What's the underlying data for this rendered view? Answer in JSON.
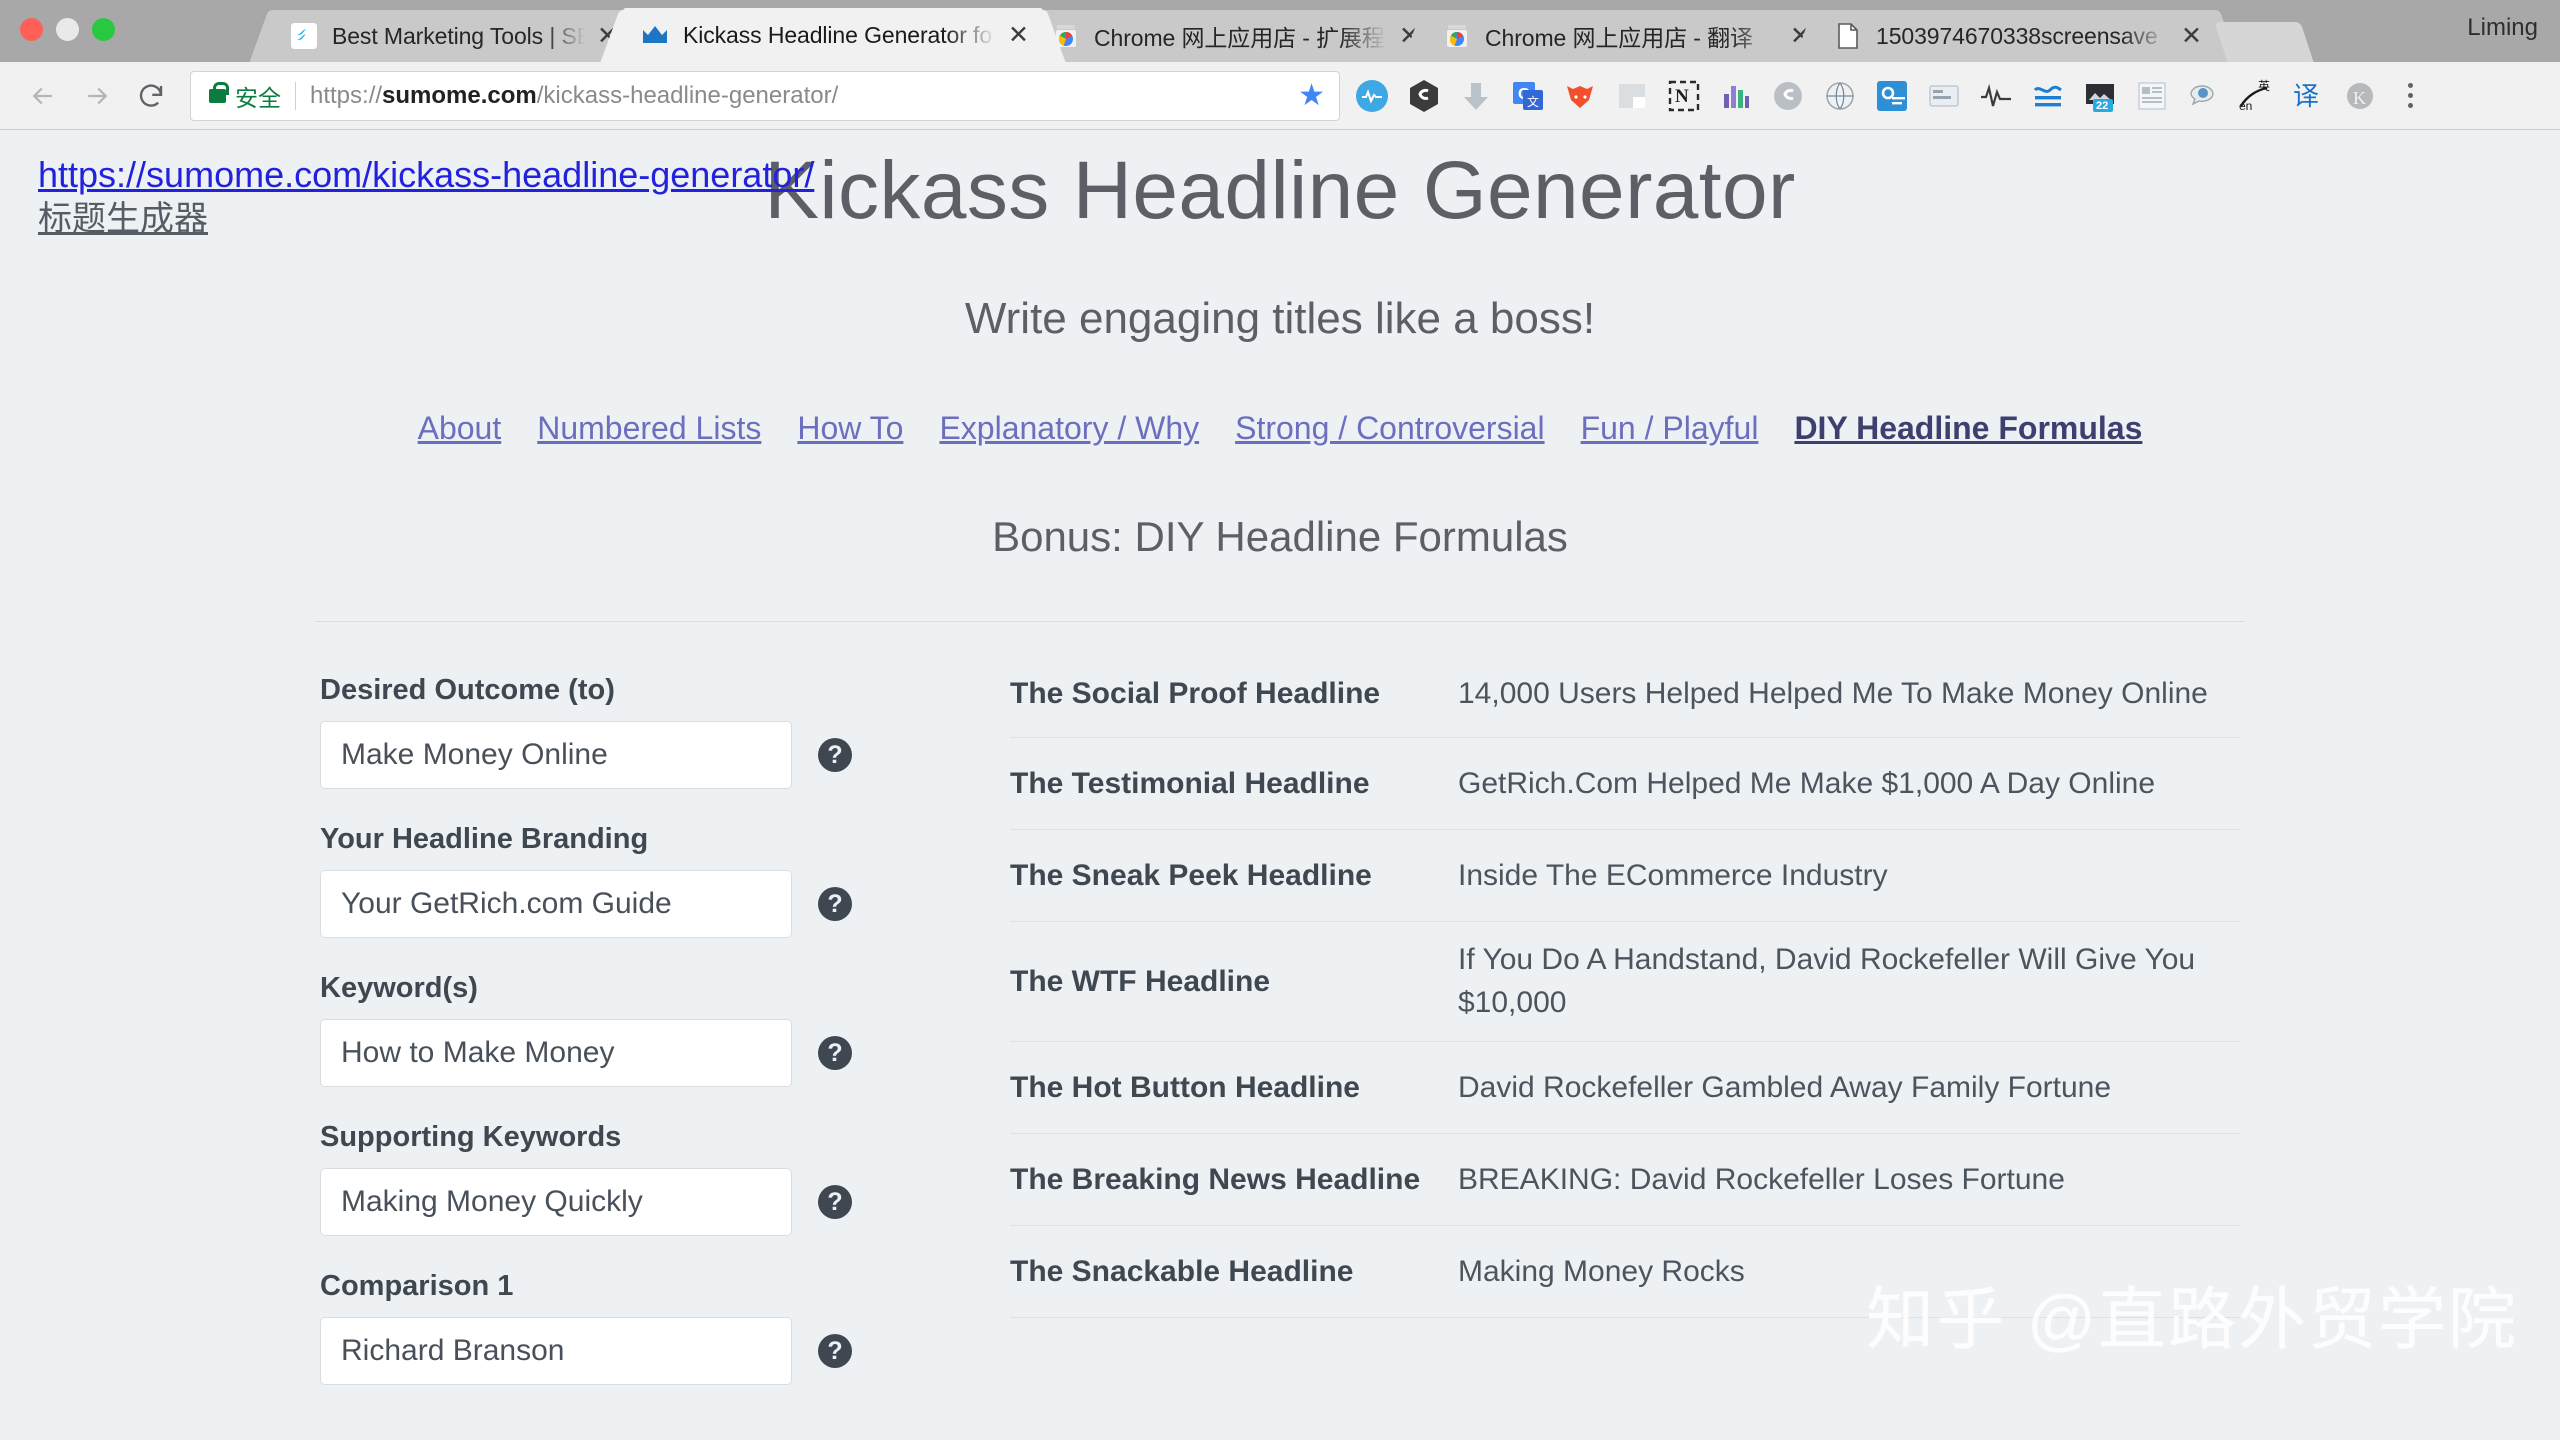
{
  "browser": {
    "profile_name": "Liming",
    "tabs": [
      {
        "title": "Best Marketing Tools | SEO To",
        "favicon": "sumo-icon",
        "active": false
      },
      {
        "title": "Kickass Headline Generator fo",
        "favicon": "crown-icon",
        "active": true
      },
      {
        "title": "Chrome 网上应用店 - 扩展程序",
        "favicon": "chrome-store-icon",
        "active": false
      },
      {
        "title": "Chrome 网上应用店 - 翻译",
        "favicon": "chrome-store-icon",
        "active": false
      },
      {
        "title": "1503974670338screensave",
        "favicon": "file-icon",
        "active": false
      }
    ],
    "nav": {
      "back_label": "←",
      "forward_label": "→",
      "reload_label": "⟳"
    },
    "omnibox": {
      "secure_label": "安全",
      "url_scheme": "https://",
      "url_host": "sumome.com",
      "url_path": "/kickass-headline-generator/",
      "bookmark_star": "★"
    },
    "extensions": [
      {
        "name": "pulse-extension-icon",
        "glyph": "∿"
      },
      {
        "name": "similarweb-extension-icon",
        "glyph": "S"
      },
      {
        "name": "download-extension-icon",
        "glyph": "⬇"
      },
      {
        "name": "google-translate-extension-icon",
        "glyph": "G"
      },
      {
        "name": "fox-extension-icon",
        "glyph": "🦊"
      },
      {
        "name": "square-extension-icon",
        "glyph": "◰"
      },
      {
        "name": "evernote-clipper-extension-icon",
        "glyph": "N"
      },
      {
        "name": "bar-chart-extension-icon",
        "glyph": "⊪"
      },
      {
        "name": "grey-similarweb-extension-icon",
        "glyph": "S"
      },
      {
        "name": "seo-globe-extension-icon",
        "glyph": "⊕"
      },
      {
        "name": "blue-gear-extension-icon",
        "glyph": "✷"
      },
      {
        "name": "blue-card-extension-icon",
        "glyph": "▤"
      },
      {
        "name": "waveform-extension-icon",
        "glyph": "⋀"
      },
      {
        "name": "wave-lines-extension-icon",
        "glyph": "≈"
      },
      {
        "name": "image-badge-extension-icon",
        "glyph": "22"
      },
      {
        "name": "document-extension-icon",
        "glyph": "▦"
      },
      {
        "name": "speech-bubble-extension-icon",
        "glyph": "◍"
      },
      {
        "name": "en-translate-extension-icon",
        "glyph": "en"
      },
      {
        "name": "yi-translate-extension-icon",
        "glyph": "译"
      },
      {
        "name": "k-profile-extension-icon",
        "glyph": "K"
      }
    ],
    "menu_label": "⋮"
  },
  "tooltip": {
    "url": "https://sumome.com/kickass-headline-generator/",
    "translated": "标题生成器"
  },
  "hero": {
    "title": "Kickass Headline Generator",
    "tagline": "Write engaging titles like a boss!"
  },
  "nav_links": [
    {
      "label": "About",
      "current": false
    },
    {
      "label": "Numbered Lists",
      "current": false
    },
    {
      "label": "How To",
      "current": false
    },
    {
      "label": "Explanatory / Why",
      "current": false
    },
    {
      "label": "Strong / Controversial",
      "current": false
    },
    {
      "label": "Fun / Playful",
      "current": false
    },
    {
      "label": "DIY Headline Formulas",
      "current": true
    }
  ],
  "section": {
    "title": "Bonus: DIY Headline Formulas"
  },
  "form": {
    "help_glyph": "?",
    "fields": [
      {
        "label": "Desired Outcome (to)",
        "value": "Make Money Online"
      },
      {
        "label": "Your Headline Branding",
        "value": "Your GetRich.com Guide"
      },
      {
        "label": "Keyword(s)",
        "value": "How to Make Money"
      },
      {
        "label": "Supporting Keywords",
        "value": "Making Money Quickly"
      },
      {
        "label": "Comparison 1",
        "value": "Richard Branson"
      }
    ]
  },
  "formulas": {
    "rows": [
      {
        "name": "The Social Proof Headline",
        "value": "14,000 Users Helped Helped Me To Make Money Online"
      },
      {
        "name": "The Testimonial Headline",
        "value": "GetRich.Com Helped Me Make $1,000 A Day Online"
      },
      {
        "name": "The Sneak Peek Headline",
        "value": "Inside The ECommerce Industry"
      },
      {
        "name": "The WTF Headline",
        "value": "If You Do A Handstand, David Rockefeller Will Give You $10,000"
      },
      {
        "name": "The Hot Button Headline",
        "value": "David Rockefeller Gambled Away Family Fortune"
      },
      {
        "name": "The Breaking News Headline",
        "value": "BREAKING: David Rockefeller Loses Fortune"
      },
      {
        "name": "The Snackable Headline",
        "value": "Making Money Rocks"
      }
    ]
  },
  "watermark": {
    "text": "知乎 @直路外贸学院"
  }
}
